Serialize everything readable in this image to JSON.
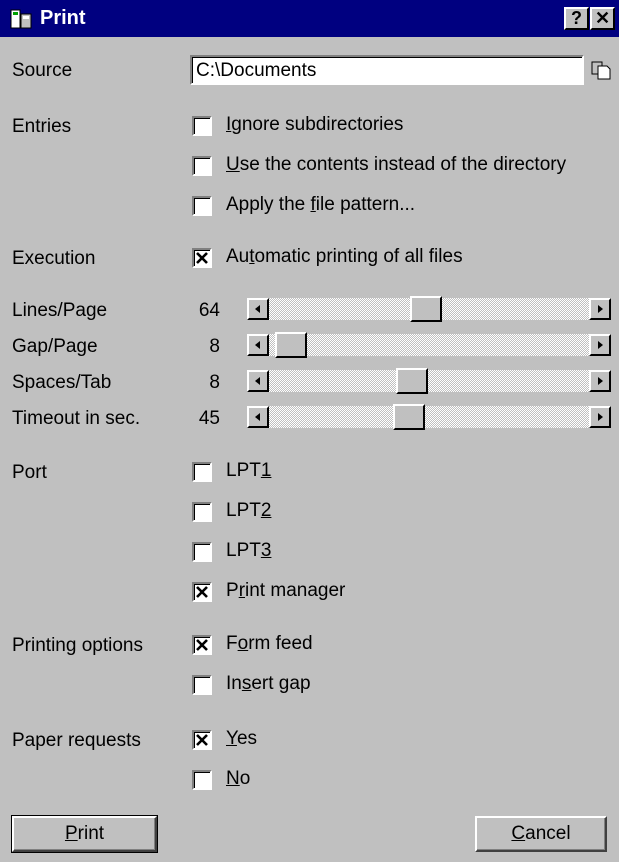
{
  "window": {
    "title": "Print",
    "help_label": "?",
    "close_label": "✕"
  },
  "source": {
    "label": "Source",
    "value": "C:\\Documents",
    "browse_icon": "copy-folder-icon"
  },
  "entries": {
    "label": "Entries",
    "options": [
      {
        "pre": "",
        "key": "I",
        "post": "gnore subdirectories",
        "checked": false
      },
      {
        "pre": "",
        "key": "U",
        "post": "se the contents instead of the directory",
        "checked": false
      },
      {
        "pre": "Apply the ",
        "key": "f",
        "post": "ile pattern...",
        "checked": false
      }
    ]
  },
  "execution": {
    "label": "Execution",
    "option": {
      "pre": "Au",
      "key": "t",
      "post": "omatic printing of all files",
      "checked": true
    }
  },
  "sliders": [
    {
      "label": "Lines/Page",
      "value": "64",
      "fraction": 0.49
    },
    {
      "label": "Gap/Page",
      "value": "8",
      "fraction": 0.02
    },
    {
      "label": "Spaces/Tab",
      "value": "8",
      "fraction": 0.44
    },
    {
      "label": "Timeout in sec.",
      "value": "45",
      "fraction": 0.43
    }
  ],
  "port": {
    "label": "Port",
    "options": [
      {
        "pre": "LPT",
        "key": "1",
        "post": "",
        "checked": false
      },
      {
        "pre": "LPT",
        "key": "2",
        "post": "",
        "checked": false
      },
      {
        "pre": "LPT",
        "key": "3",
        "post": "",
        "checked": false
      },
      {
        "pre": "P",
        "key": "r",
        "post": "int manager",
        "checked": true
      }
    ]
  },
  "printing_options": {
    "label": "Printing options",
    "options": [
      {
        "pre": "F",
        "key": "o",
        "post": "rm feed",
        "checked": true
      },
      {
        "pre": "In",
        "key": "s",
        "post": "ert gap",
        "checked": false
      }
    ]
  },
  "paper_requests": {
    "label": "Paper requests",
    "options": [
      {
        "pre": "",
        "key": "Y",
        "post": "es",
        "checked": true
      },
      {
        "pre": "",
        "key": "N",
        "post": "o",
        "checked": false
      }
    ]
  },
  "buttons": {
    "print": {
      "pre": "",
      "key": "P",
      "post": "rint"
    },
    "cancel": {
      "pre": "",
      "key": "C",
      "post": "ancel"
    }
  }
}
